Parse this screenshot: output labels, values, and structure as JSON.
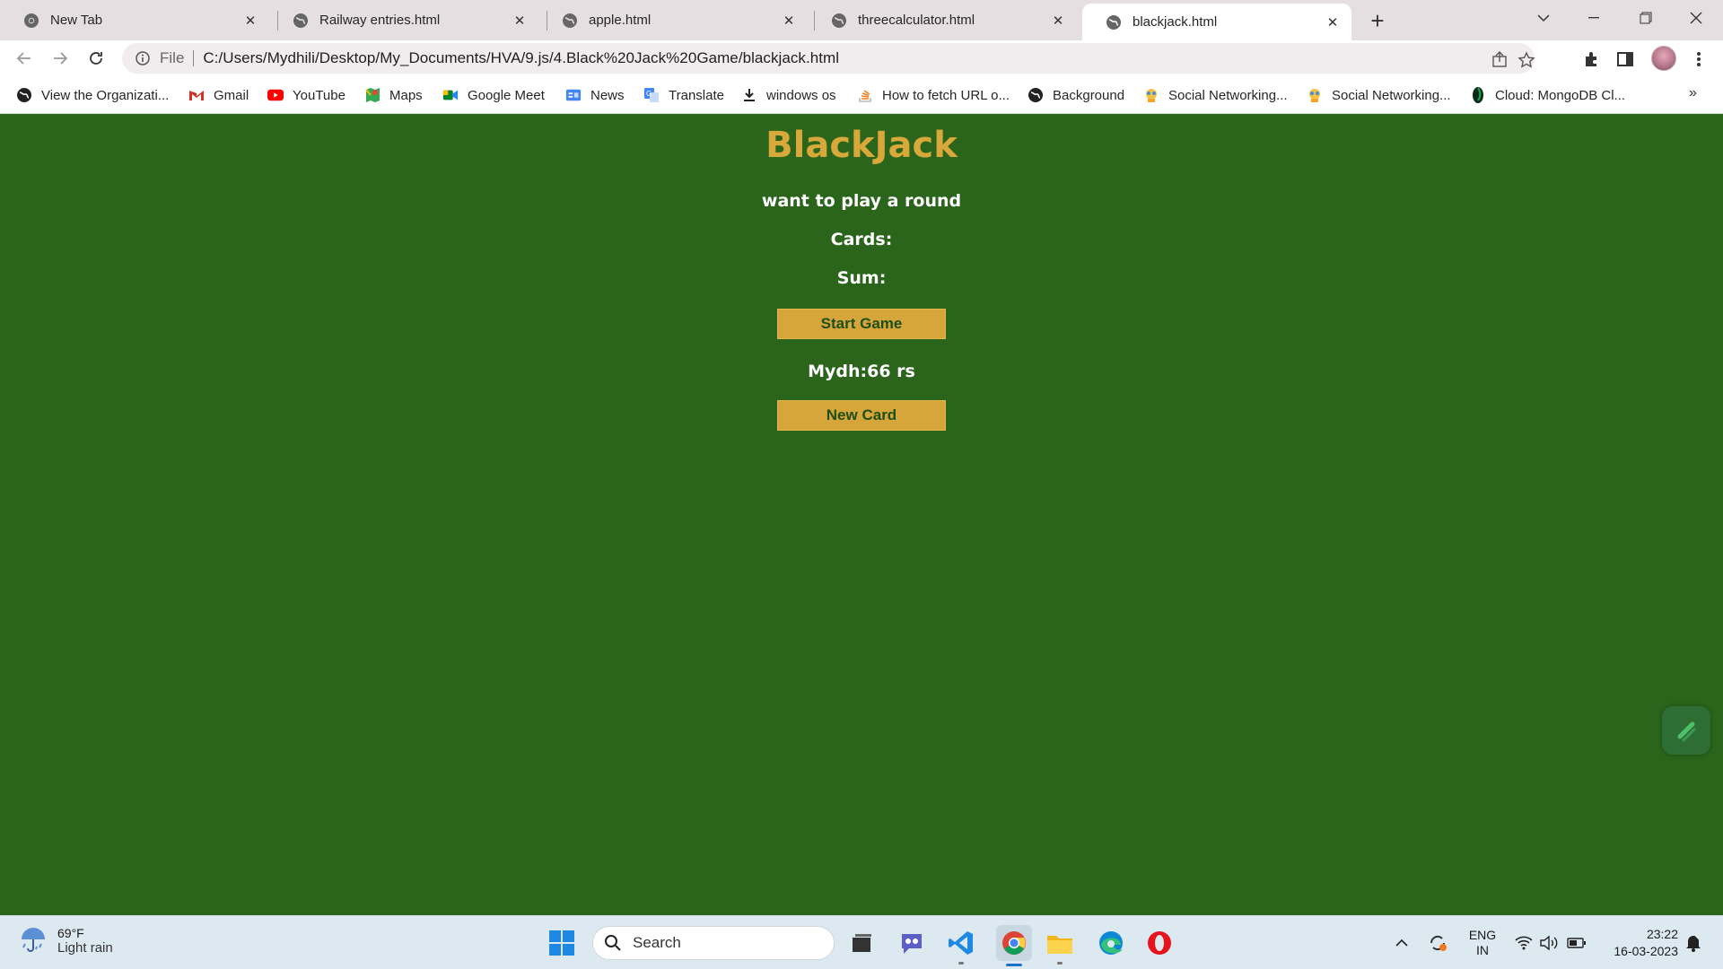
{
  "browser": {
    "tabs": [
      {
        "label": "New Tab",
        "icon": "chrome-icon",
        "active": false
      },
      {
        "label": "Railway entries.html",
        "icon": "globe-icon",
        "active": false
      },
      {
        "label": "apple.html",
        "icon": "globe-icon",
        "active": false
      },
      {
        "label": "threecalculator.html",
        "icon": "globe-icon",
        "active": false
      },
      {
        "label": "blackjack.html",
        "icon": "globe-icon",
        "active": true
      }
    ],
    "address": {
      "scheme_label": "File",
      "url": "C:/Users/Mydhili/Desktop/My_Documents/HVA/9.js/4.Black%20Jack%20Game/blackjack.html"
    },
    "bookmarks": [
      {
        "label": "View the Organizati...",
        "icon": "globe-icon"
      },
      {
        "label": "Gmail",
        "icon": "gmail-icon"
      },
      {
        "label": "YouTube",
        "icon": "youtube-icon"
      },
      {
        "label": "Maps",
        "icon": "maps-icon"
      },
      {
        "label": "Google Meet",
        "icon": "meet-icon"
      },
      {
        "label": "News",
        "icon": "news-icon"
      },
      {
        "label": "Translate",
        "icon": "translate-icon"
      },
      {
        "label": "windows os",
        "icon": "download-icon"
      },
      {
        "label": "How to fetch URL o...",
        "icon": "stack-icon"
      },
      {
        "label": "Background",
        "icon": "globe-icon"
      },
      {
        "label": "Social Networking...",
        "icon": "social-icon"
      },
      {
        "label": "Social Networking...",
        "icon": "social-icon"
      },
      {
        "label": "Cloud: MongoDB Cl...",
        "icon": "mongodb-icon"
      }
    ],
    "bookmarks_more": "»"
  },
  "game": {
    "title": "BlackJack",
    "message": "want to play a round",
    "cards_label": "Cards:",
    "sum_label": "Sum:",
    "start_button": "Start Game",
    "player": "Mydh:66 rs",
    "new_card_button": "New Card"
  },
  "colors": {
    "page_bg": "#2b651b",
    "title": "#d8a93a",
    "button_bg": "#d6a63a",
    "button_text": "#1f4e12"
  },
  "taskbar": {
    "weather_temp": "69°F",
    "weather_desc": "Light rain",
    "search_placeholder": "Search",
    "lang_top": "ENG",
    "lang_bottom": "IN",
    "time": "23:22",
    "date": "16-03-2023"
  }
}
